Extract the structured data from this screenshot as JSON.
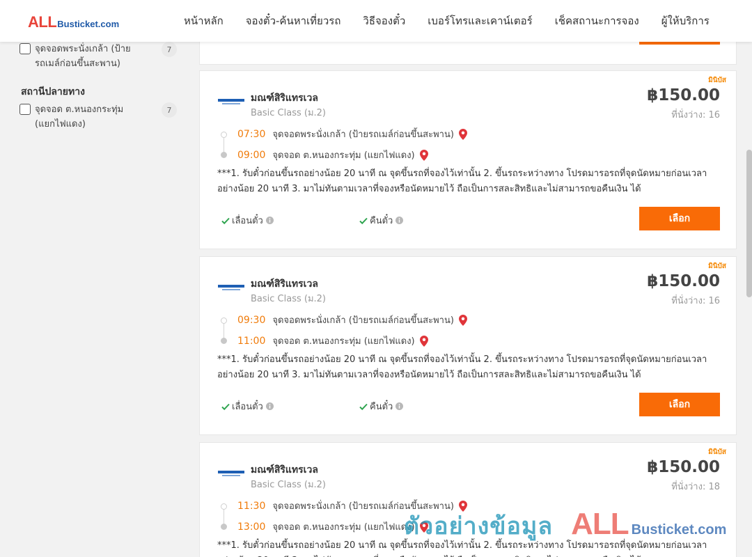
{
  "header": {
    "logo_all": "ALL",
    "logo_rest": "Busticket.com",
    "nav": [
      "หน้าหลัก",
      "จองตั๋ว-ค้นหาเที่ยวรถ",
      "วิธีจองตั๋ว",
      "เบอร์โทรและเคาน์เตอร์",
      "เช็คสถานะการจอง",
      "ผู้ให้บริการ"
    ]
  },
  "sidebar": {
    "origin_filter": {
      "label": "จุดจอดพระนั่งเกล้า (ป้ายรถเมล์ก่อนขึ้นสะพาน)",
      "count": "7"
    },
    "destination_title": "สถานีปลายทาง",
    "destination_filter": {
      "label": "จุดจอด ต.หนองกระทุ่ม (แยกไฟแดง)",
      "count": "7"
    }
  },
  "common": {
    "badge": "มินิบัส",
    "operator": "มณฑ์สิริแทรเวล",
    "bus_class": "Basic Class (ม.2)",
    "price": "฿150.00",
    "origin": "จุดจอดพระนั่งเกล้า (ป้ายรถเมล์ก่อนขึ้นสะพาน)",
    "destination": "จุดจอด ต.หนองกระทุ่ม (แยกไฟแดง)",
    "remark": "***1. รับตั๋วก่อนขึ้นรถอย่างน้อย 20 นาที ณ จุดขึ้นรถที่จองไว้เท่านั้น 2. ขึ้นรถระหว่างทาง โปรดมารอรถที่จุดนัดหมายก่อนเวลาอย่างน้อย 20 นาที 3. มาไม่ทันตามเวลาที่จองหรือนัดหมายไว้ ถือเป็นการสละสิทธิและไม่สามารถขอคืนเงิน ได้",
    "feature_postpone": "เลื่อนตั๋ว",
    "feature_refund": "คืนตั๋ว",
    "select_label": "เลือก"
  },
  "trips": [
    {
      "seats": "ที่นั่งว่าง: 16",
      "depart": "07:30",
      "arrive": "09:00"
    },
    {
      "seats": "ที่นั่งว่าง: 16",
      "depart": "09:30",
      "arrive": "11:00"
    },
    {
      "seats": "ที่นั่งว่าง: 18",
      "depart": "11:30",
      "arrive": "13:00"
    }
  ],
  "watermark": {
    "text": "ตัวอย่างข้อมูล",
    "all": "ALL",
    "rest": "Busticket.com"
  },
  "colors": {
    "accent": "#f96b07",
    "time": "#f07b0a",
    "brand_red": "#e8443a",
    "brand_blue": "#1f5aa8"
  }
}
